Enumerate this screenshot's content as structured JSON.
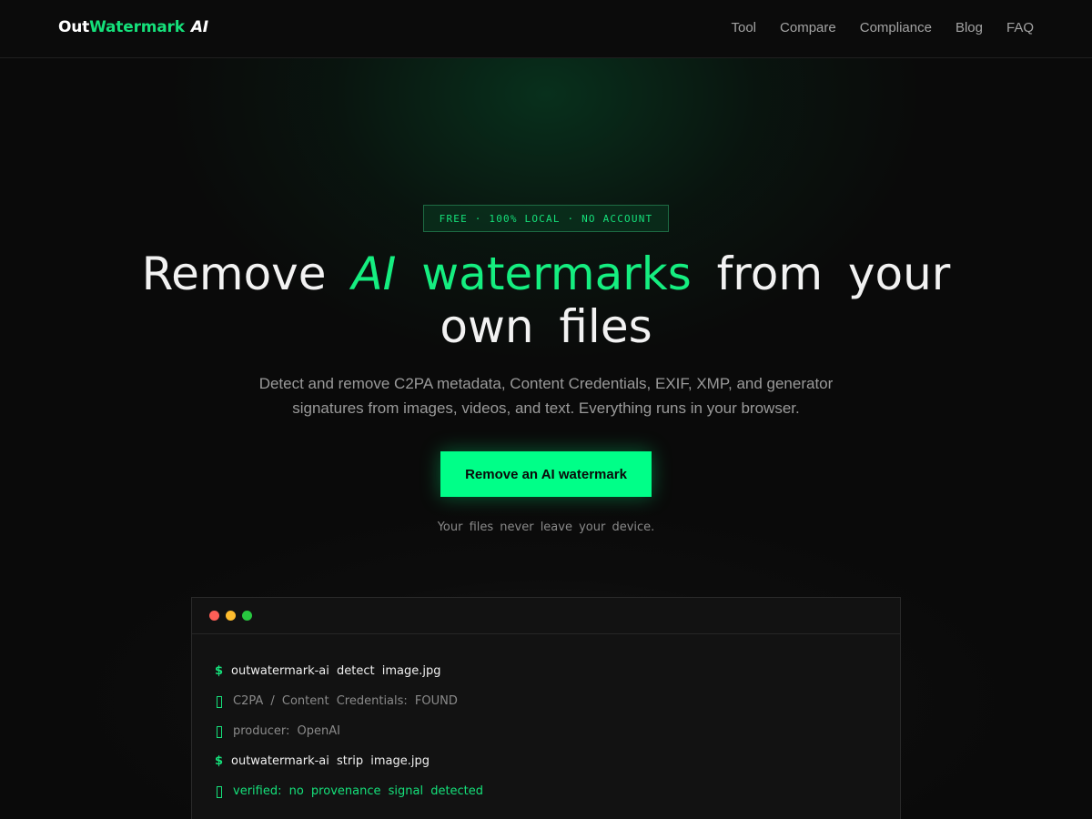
{
  "header": {
    "logo": {
      "part1": "Out",
      "part2": "Watermark",
      "part3": "AI"
    },
    "nav": [
      "Tool",
      "Compare",
      "Compliance",
      "Blog",
      "FAQ"
    ]
  },
  "hero": {
    "badge": "FREE · 100% LOCAL · NO ACCOUNT",
    "title_part1": "Remove ",
    "title_highlight_ai": "AI",
    "title_highlight_rest": " watermarks",
    "title_part2": " from your own files",
    "subtitle": "Detect and remove C2PA metadata, Content Credentials, EXIF, XMP, and generator signatures from images, videos, and text. Everything runs in your browser.",
    "cta_label": "Remove an AI watermark",
    "note": "Your files never leave your device."
  },
  "terminal": {
    "lines": [
      {
        "kind": "cmd",
        "symbol": "$",
        "text": "outwatermark-ai detect image.jpg"
      },
      {
        "kind": "out",
        "symbol": "box",
        "text": "C2PA / Content Credentials: FOUND"
      },
      {
        "kind": "out",
        "symbol": "box",
        "text": "producer: OpenAI"
      },
      {
        "kind": "cmd",
        "symbol": "$",
        "text": "outwatermark-ai strip image.jpg"
      },
      {
        "kind": "ok",
        "symbol": "box",
        "text": "verified: no provenance signal detected"
      }
    ]
  },
  "colors": {
    "background": "#0a0a0a",
    "accent": "#15e07a",
    "cta": "#00ff88",
    "dot_red": "#ff5f57",
    "dot_yellow": "#febc2e",
    "dot_green": "#28c840"
  }
}
